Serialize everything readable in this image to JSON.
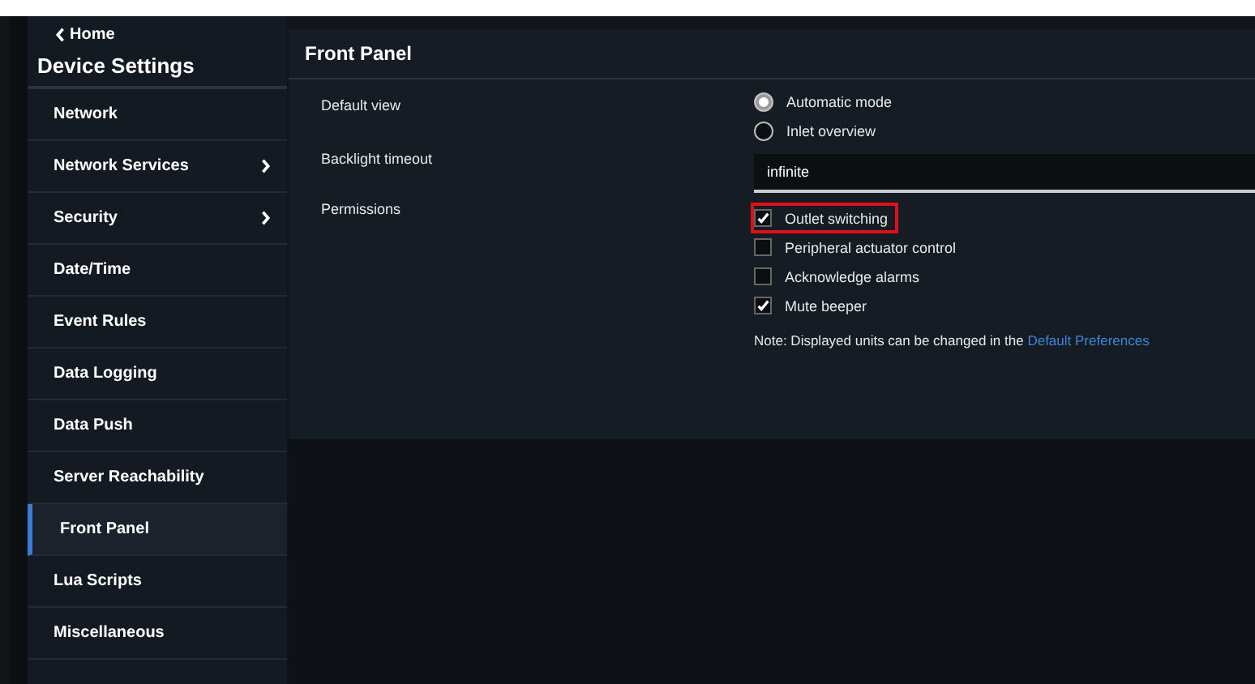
{
  "sidebar": {
    "back": "Home",
    "title": "Device Settings",
    "items": [
      {
        "label": "Network",
        "submenu": false,
        "selected": false
      },
      {
        "label": "Network Services",
        "submenu": true,
        "selected": false
      },
      {
        "label": "Security",
        "submenu": true,
        "selected": false
      },
      {
        "label": "Date/Time",
        "submenu": false,
        "selected": false
      },
      {
        "label": "Event Rules",
        "submenu": false,
        "selected": false
      },
      {
        "label": "Data Logging",
        "submenu": false,
        "selected": false
      },
      {
        "label": "Data Push",
        "submenu": false,
        "selected": false
      },
      {
        "label": "Server Reachability",
        "submenu": false,
        "selected": false
      },
      {
        "label": "Front Panel",
        "submenu": false,
        "selected": true
      },
      {
        "label": "Lua Scripts",
        "submenu": false,
        "selected": false
      },
      {
        "label": "Miscellaneous",
        "submenu": false,
        "selected": false
      }
    ]
  },
  "panel": {
    "title": "Front Panel",
    "default_view": {
      "label": "Default view",
      "options": [
        {
          "label": "Automatic mode",
          "selected": true
        },
        {
          "label": "Inlet overview",
          "selected": false
        }
      ]
    },
    "backlight_timeout": {
      "label": "Backlight timeout",
      "value": "infinite"
    },
    "permissions": {
      "label": "Permissions",
      "items": [
        {
          "label": "Outlet switching",
          "checked": true,
          "highlighted": true
        },
        {
          "label": "Peripheral actuator control",
          "checked": false,
          "highlighted": false
        },
        {
          "label": "Acknowledge alarms",
          "checked": false,
          "highlighted": false
        },
        {
          "label": "Mute beeper",
          "checked": true,
          "highlighted": false
        }
      ]
    },
    "note": "Note: Displayed units can be changed in the",
    "note_link": "Default Preferences"
  }
}
